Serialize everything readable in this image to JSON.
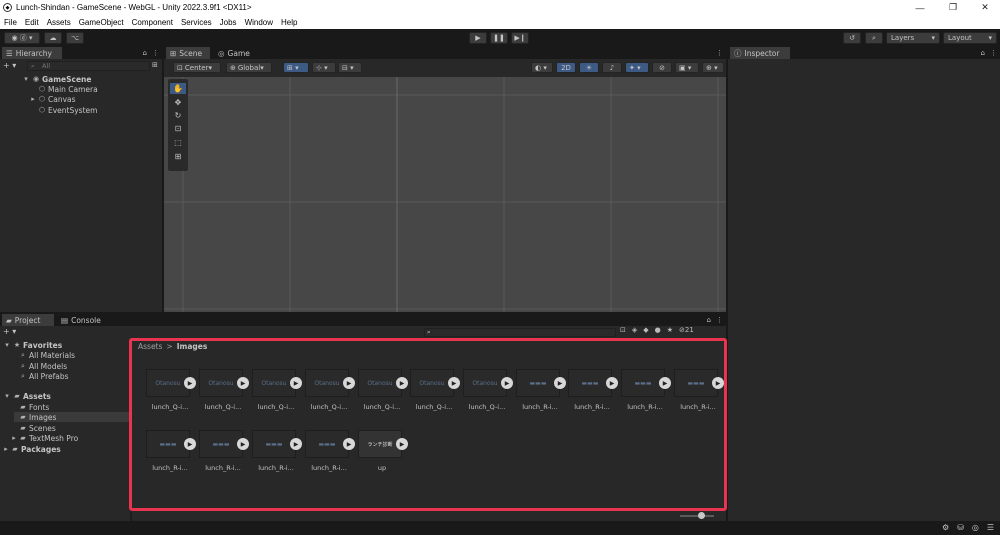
{
  "window": {
    "title": "Lunch-Shindan - GameScene - WebGL - Unity 2022.3.9f1 <DX11>",
    "minimize": "—",
    "maximize": "❐",
    "close": "✕"
  },
  "menu": [
    "File",
    "Edit",
    "Assets",
    "GameObject",
    "Component",
    "Services",
    "Jobs",
    "Window",
    "Help"
  ],
  "toolbar": {
    "account": "◉ ⓓ ▾",
    "cloud": "☁",
    "collab": "⌥",
    "play": "▶",
    "pause": "❚❚",
    "step": "▶❙",
    "history": "↺",
    "search": "⌕",
    "layers": "Layers",
    "layout": "Layout"
  },
  "hierarchy": {
    "tab": "Hierarchy",
    "add": "+ ▾",
    "search_placeholder": "All",
    "scene": "GameScene",
    "items": [
      "Main Camera",
      "Canvas",
      "EventSystem"
    ]
  },
  "scene_view": {
    "tabs": [
      "Scene",
      "Game"
    ],
    "pivot": "Center",
    "space": "Global",
    "mode_2d": "2D"
  },
  "inspector": {
    "tab": "Inspector"
  },
  "project": {
    "tabs": [
      "Project",
      "Console"
    ],
    "add": "+ ▾",
    "hidden_count": "21",
    "favorites": {
      "label": "Favorites",
      "items": [
        "All Materials",
        "All Models",
        "All Prefabs"
      ]
    },
    "assets": {
      "label": "Assets",
      "items": [
        "Fonts",
        "Images",
        "Scenes",
        "TextMesh Pro"
      ]
    },
    "packages": "Packages",
    "breadcrumb": {
      "root": "Assets",
      "sep": ">",
      "current": "Images"
    },
    "files": [
      {
        "name": "lunch_Q-i...",
        "thumb": "Otanosu"
      },
      {
        "name": "lunch_Q-i...",
        "thumb": "Otanosu"
      },
      {
        "name": "lunch_Q-i...",
        "thumb": "Otanosu"
      },
      {
        "name": "lunch_Q-i...",
        "thumb": "Otanosu"
      },
      {
        "name": "lunch_Q-i...",
        "thumb": "Otanosu"
      },
      {
        "name": "lunch_Q-i...",
        "thumb": "Otanosu"
      },
      {
        "name": "lunch_Q-i...",
        "thumb": "Otanosu"
      },
      {
        "name": "lunch_R-i...",
        "thumb": "▬▬▬"
      },
      {
        "name": "lunch_R-i...",
        "thumb": "▬▬▬"
      },
      {
        "name": "lunch_R-i...",
        "thumb": "▬▬▬"
      },
      {
        "name": "lunch_R-i...",
        "thumb": "▬▬▬"
      },
      {
        "name": "lunch_R-i...",
        "thumb": "▬▬▬"
      },
      {
        "name": "lunch_R-i...",
        "thumb": "▬▬▬"
      },
      {
        "name": "lunch_R-i...",
        "thumb": "▬▬▬"
      },
      {
        "name": "lunch_R-i...",
        "thumb": "▬▬▬"
      },
      {
        "name": "up",
        "thumb": "ランチ診断"
      }
    ]
  },
  "colors": {
    "highlight": "#e8344e",
    "panel": "#282828",
    "background": "#191919"
  }
}
